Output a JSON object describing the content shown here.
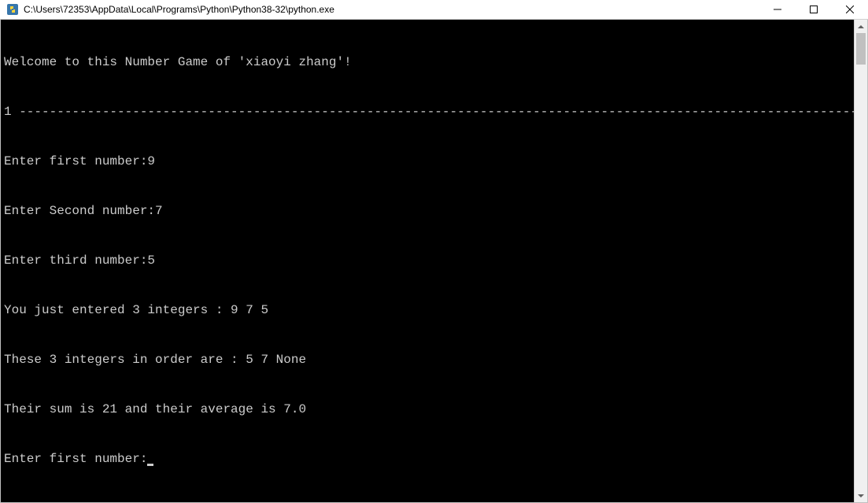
{
  "window": {
    "title": "C:\\Users\\72353\\AppData\\Local\\Programs\\Python\\Python38-32\\python.exe"
  },
  "console": {
    "lines": [
      "Welcome to this Number Game of 'xiaoyi zhang'!",
      "1 --------------------------------------------------------------------------------------------------------------------",
      "Enter first number:9",
      "Enter Second number:7",
      "Enter third number:5",
      "You just entered 3 integers : 9 7 5",
      "These 3 integers in order are : 5 7 None",
      "Their sum is 21 and their average is 7.0",
      "Enter first number:"
    ]
  },
  "icons": {
    "python": "py",
    "minimize": "—",
    "maximize": "☐",
    "close": "✕",
    "arrow_up": "▲",
    "arrow_down": "▼"
  }
}
